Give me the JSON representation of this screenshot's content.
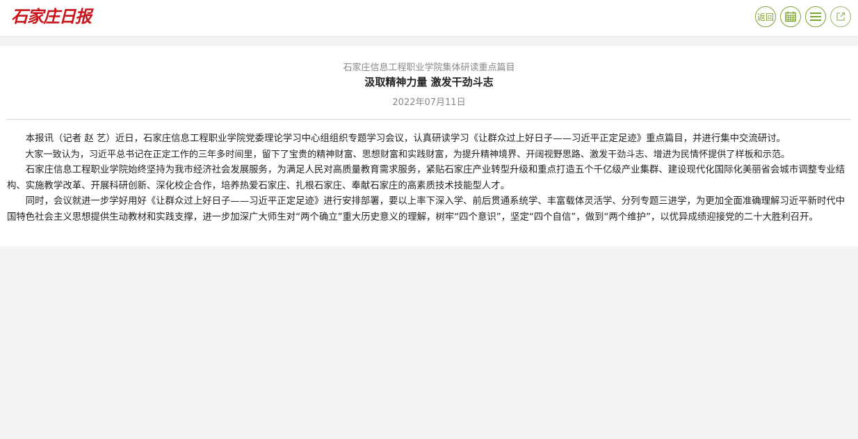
{
  "header": {
    "logo_text": "石家庄日报",
    "buttons": [
      {
        "label": "返回",
        "icon": "back-text"
      },
      {
        "label": "",
        "icon": "calendar-icon"
      },
      {
        "label": "",
        "icon": "menu-icon"
      },
      {
        "label": "",
        "icon": "share-icon"
      }
    ],
    "accent_color": "#7aa529",
    "logo_color": "#c8161d"
  },
  "article": {
    "subtitle": "石家庄信息工程职业学院集体研读重点篇目",
    "title": "汲取精神力量 激发干劲斗志",
    "date": "2022年07月11日",
    "paragraphs": [
      "本报讯（记者 赵 艺）近日，石家庄信息工程职业学院党委理论学习中心组组织专题学习会议，认真研读学习《让群众过上好日子——习近平正定足迹》重点篇目，并进行集中交流研讨。",
      "大家一致认为，习近平总书记在正定工作的三年多时间里，留下了宝贵的精神财富、思想财富和实践财富，为提升精神境界、开阔视野思路、激发干劲斗志、增进为民情怀提供了样板和示范。",
      "石家庄信息工程职业学院始终坚持为我市经济社会发展服务，为满足人民对高质量教育需求服务，紧贴石家庄产业转型升级和重点打造五个千亿级产业集群、建设现代化国际化美丽省会城市调整专业结构、实施教学改革、开展科研创新、深化校企合作，培养热爱石家庄、扎根石家庄、奉献石家庄的高素质技术技能型人才。",
      "同时，会议就进一步学好用好《让群众过上好日子——习近平正定足迹》进行安排部署，要以上率下深入学、前后贯通系统学、丰富载体灵活学、分列专题三进学，为更加全面准确理解习近平新时代中国特色社会主义思想提供生动教材和实践支撑，进一步加深广大师生对“两个确立”重大历史意义的理解，树牢“四个意识”，坚定“四个自信”，做到“两个维护”，以优异成绩迎接党的二十大胜利召开。"
    ]
  }
}
